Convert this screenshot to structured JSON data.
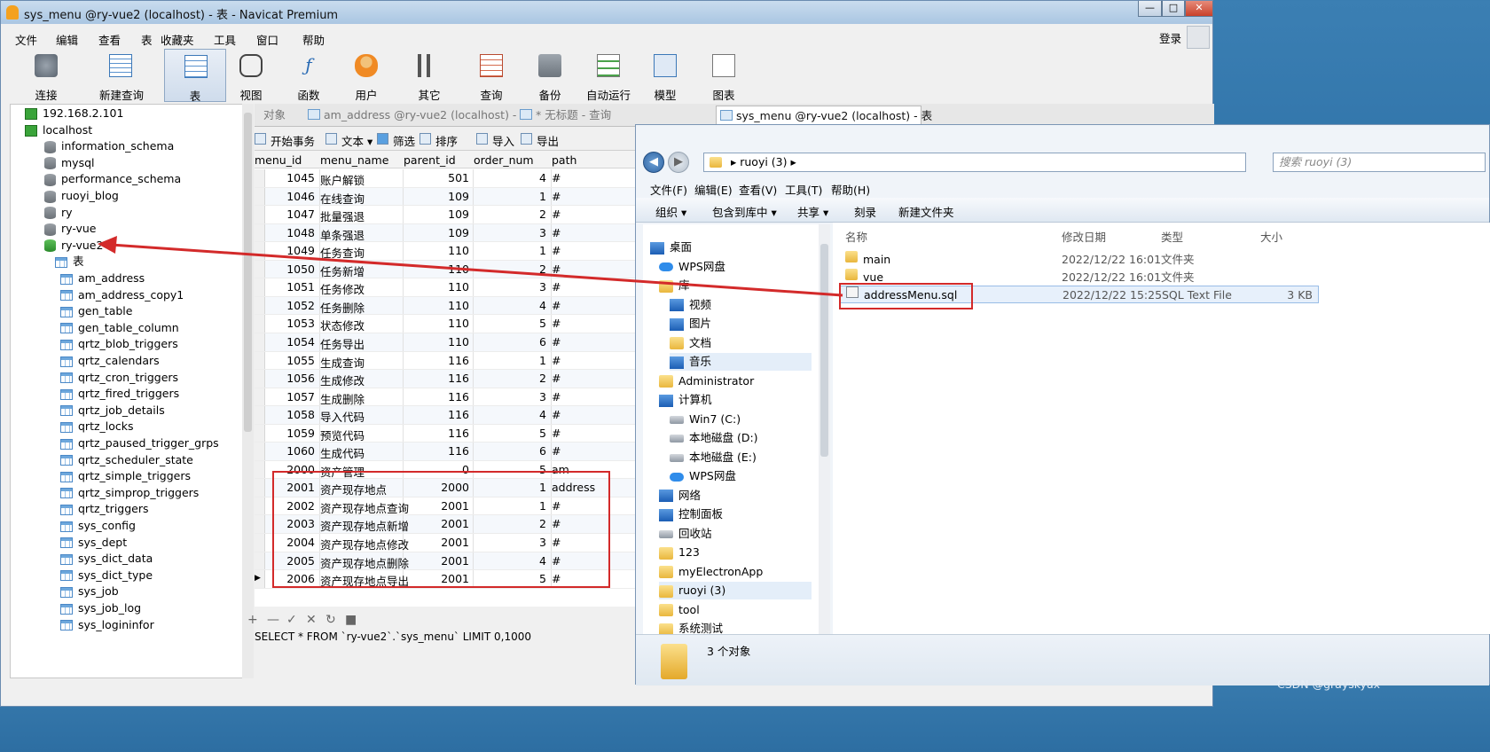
{
  "navicat": {
    "title": "sys_menu @ry-vue2 (localhost) - 表 - Navicat Premium",
    "window_buttons": [
      "—",
      "□",
      "✕"
    ],
    "menu": [
      "文件",
      "编辑",
      "查看",
      "表",
      "收藏夹",
      "工具",
      "窗口",
      "帮助"
    ],
    "login": "登录",
    "toolbar": [
      "连接",
      "新建查询",
      "表",
      "视图",
      "函数",
      "用户",
      "其它",
      "查询",
      "备份",
      "自动运行",
      "模型",
      "图表"
    ],
    "tree": [
      {
        "label": "192.168.2.101",
        "kind": "server"
      },
      {
        "label": "localhost",
        "kind": "server"
      },
      {
        "label": "information_schema",
        "kind": "db"
      },
      {
        "label": "mysql",
        "kind": "db"
      },
      {
        "label": "performance_schema",
        "kind": "db"
      },
      {
        "label": "ruoyi_blog",
        "kind": "db"
      },
      {
        "label": "ry",
        "kind": "db"
      },
      {
        "label": "ry-vue",
        "kind": "db"
      },
      {
        "label": "ry-vue2",
        "kind": "db-open"
      },
      {
        "label": "表",
        "kind": "folder"
      }
    ],
    "tables": [
      "am_address",
      "am_address_copy1",
      "gen_table",
      "gen_table_column",
      "qrtz_blob_triggers",
      "qrtz_calendars",
      "qrtz_cron_triggers",
      "qrtz_fired_triggers",
      "qrtz_job_details",
      "qrtz_locks",
      "qrtz_paused_trigger_grps",
      "qrtz_scheduler_state",
      "qrtz_simple_triggers",
      "qrtz_simprop_triggers",
      "qrtz_triggers",
      "sys_config",
      "sys_dept",
      "sys_dict_data",
      "sys_dict_type",
      "sys_job",
      "sys_job_log",
      "sys_logininfor"
    ],
    "tabs": [
      "对象",
      "am_address @ry-vue2 (localhost) - 表",
      "* 无标题 - 查询",
      "sys_menu @ry-vue2 (localhost) - 表"
    ],
    "subtoolbar": [
      "开始事务",
      "文本",
      "筛选",
      "排序",
      "导入",
      "导出"
    ],
    "columns": [
      "menu_id",
      "menu_name",
      "parent_id",
      "order_num",
      "path"
    ],
    "rows": [
      [
        "1045",
        "账户解锁",
        "501",
        "4",
        "#"
      ],
      [
        "1046",
        "在线查询",
        "109",
        "1",
        "#"
      ],
      [
        "1047",
        "批量强退",
        "109",
        "2",
        "#"
      ],
      [
        "1048",
        "单条强退",
        "109",
        "3",
        "#"
      ],
      [
        "1049",
        "任务查询",
        "110",
        "1",
        "#"
      ],
      [
        "1050",
        "任务新增",
        "110",
        "2",
        "#"
      ],
      [
        "1051",
        "任务修改",
        "110",
        "3",
        "#"
      ],
      [
        "1052",
        "任务删除",
        "110",
        "4",
        "#"
      ],
      [
        "1053",
        "状态修改",
        "110",
        "5",
        "#"
      ],
      [
        "1054",
        "任务导出",
        "110",
        "6",
        "#"
      ],
      [
        "1055",
        "生成查询",
        "116",
        "1",
        "#"
      ],
      [
        "1056",
        "生成修改",
        "116",
        "2",
        "#"
      ],
      [
        "1057",
        "生成删除",
        "116",
        "3",
        "#"
      ],
      [
        "1058",
        "导入代码",
        "116",
        "4",
        "#"
      ],
      [
        "1059",
        "预览代码",
        "116",
        "5",
        "#"
      ],
      [
        "1060",
        "生成代码",
        "116",
        "6",
        "#"
      ],
      [
        "2000",
        "资产管理",
        "0",
        "5",
        "am"
      ],
      [
        "2001",
        "资产现存地点",
        "2000",
        "1",
        "address"
      ],
      [
        "2002",
        "资产现存地点查询",
        "2001",
        "1",
        "#"
      ],
      [
        "2003",
        "资产现存地点新增",
        "2001",
        "2",
        "#"
      ],
      [
        "2004",
        "资产现存地点修改",
        "2001",
        "3",
        "#"
      ],
      [
        "2005",
        "资产现存地点删除",
        "2001",
        "4",
        "#"
      ],
      [
        "2006",
        "资产现存地点导出",
        "2001",
        "5",
        "#"
      ]
    ],
    "grid_controls": [
      "+",
      "—",
      "✓",
      "✕",
      "↻",
      "■"
    ],
    "status_sql": "SELECT * FROM `ry-vue2`.`sys_menu` LIMIT 0,1000"
  },
  "explorer": {
    "breadcrumb": "ruoyi (3)",
    "search_placeholder": "搜索 ruoyi (3)",
    "menu": [
      "文件(F)",
      "编辑(E)",
      "查看(V)",
      "工具(T)",
      "帮助(H)"
    ],
    "commands": [
      "组织 ▾",
      "包含到库中 ▾",
      "共享 ▾",
      "刻录",
      "新建文件夹"
    ],
    "nav": [
      {
        "label": "桌面",
        "icon": "desktop"
      },
      {
        "label": "WPS网盘",
        "icon": "cloud"
      },
      {
        "label": "库",
        "icon": "library"
      },
      {
        "label": "视频",
        "icon": "video"
      },
      {
        "label": "图片",
        "icon": "picture"
      },
      {
        "label": "文档",
        "icon": "document"
      },
      {
        "label": "音乐",
        "icon": "music"
      },
      {
        "label": "Administrator",
        "icon": "user-folder"
      },
      {
        "label": "计算机",
        "icon": "computer"
      },
      {
        "label": "Win7 (C:)",
        "icon": "drive"
      },
      {
        "label": "本地磁盘 (D:)",
        "icon": "drive"
      },
      {
        "label": "本地磁盘 (E:)",
        "icon": "drive"
      },
      {
        "label": "WPS网盘",
        "icon": "cloud"
      },
      {
        "label": "网络",
        "icon": "network"
      },
      {
        "label": "控制面板",
        "icon": "control-panel"
      },
      {
        "label": "回收站",
        "icon": "recycle-bin"
      },
      {
        "label": "123",
        "icon": "folder"
      },
      {
        "label": "myElectronApp",
        "icon": "folder"
      },
      {
        "label": "ruoyi (3)",
        "icon": "folder"
      },
      {
        "label": "tool",
        "icon": "folder"
      },
      {
        "label": "系统测试",
        "icon": "folder"
      }
    ],
    "headers": [
      "名称",
      "修改日期",
      "类型",
      "大小"
    ],
    "files": [
      {
        "name": "main",
        "date": "2022/12/22 16:01",
        "type": "文件夹",
        "size": ""
      },
      {
        "name": "vue",
        "date": "2022/12/22 16:01",
        "type": "文件夹",
        "size": ""
      },
      {
        "name": "addressMenu.sql",
        "date": "2022/12/22 15:25",
        "type": "SQL Text File",
        "size": "3 KB"
      }
    ],
    "count": "3 个对象"
  },
  "watermark": "CSDN @grayskyax",
  "colors": {
    "highlight_box": "#d32a2a",
    "selection": "#e7f0fb"
  }
}
